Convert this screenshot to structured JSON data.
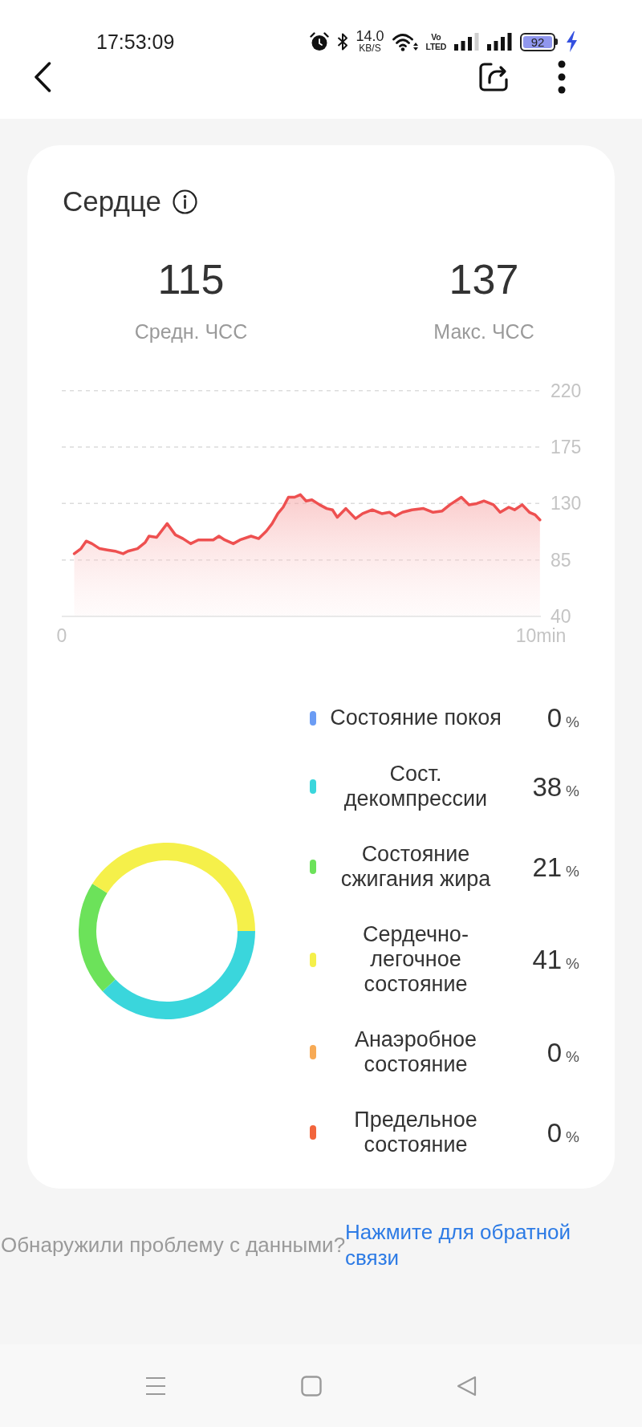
{
  "status_bar": {
    "time": "17:53:09",
    "net_speed": "14.0",
    "net_speed_unit": "KB/S",
    "volte_top": "Vo",
    "volte_bottom": "LTED",
    "battery": "92"
  },
  "card": {
    "title": "Сердце",
    "stats": [
      {
        "value": "115",
        "label": "Средн. ЧСС"
      },
      {
        "value": "137",
        "label": "Макс. ЧСС"
      }
    ],
    "heart_rate": {
      "chart_data": {
        "type": "area",
        "x": [
          0.26,
          0.4,
          0.51,
          0.63,
          0.79,
          0.95,
          1.11,
          1.28,
          1.38,
          1.58,
          1.74,
          1.82,
          1.98,
          2.2,
          2.37,
          2.53,
          2.69,
          2.85,
          3.16,
          3.28,
          3.4,
          3.58,
          3.72,
          3.95,
          4.11,
          4.27,
          4.39,
          4.51,
          4.62,
          4.73,
          4.86,
          4.98,
          5.1,
          5.22,
          5.38,
          5.53,
          5.65,
          5.75,
          5.93,
          6.13,
          6.28,
          6.48,
          6.68,
          6.84,
          6.96,
          7.11,
          7.31,
          7.55,
          7.75,
          7.94,
          8.1,
          8.34,
          8.5,
          8.66,
          8.81,
          9.01,
          9.15,
          9.33,
          9.45,
          9.61,
          9.76,
          9.88,
          9.98
        ],
        "values": [
          90,
          94,
          100,
          98,
          94,
          93,
          92,
          90,
          92,
          94,
          99,
          104,
          103,
          114,
          105,
          102,
          98,
          101,
          101,
          104,
          101,
          98,
          101,
          104,
          102,
          108,
          114,
          122,
          127,
          135,
          135,
          137,
          132,
          133,
          129,
          126,
          125,
          119,
          126,
          118,
          122,
          125,
          122,
          123,
          120,
          123,
          125,
          126,
          123,
          124,
          129,
          135,
          129,
          130,
          132,
          129,
          123,
          127,
          125,
          129,
          123,
          121,
          117
        ],
        "xlim": [
          0,
          10
        ],
        "ylim": [
          40,
          220
        ],
        "xticks": [
          {
            "value": 0,
            "label": "0"
          },
          {
            "value": 10,
            "label": "10min"
          }
        ],
        "yticks": [
          40,
          85,
          130,
          175,
          220
        ],
        "grid": true
      }
    },
    "zones": {
      "chart_data": {
        "type": "donut",
        "categories": [
          "Состояние покоя",
          "Сост. декомпрессии",
          "Состояние сжигания жира",
          "Сердечно-легочное состояние",
          "Анаэробное состояние",
          "Предельное состояние"
        ],
        "values": [
          0,
          38,
          21,
          41,
          0,
          0
        ]
      },
      "legend": [
        {
          "color": "#6b9cf4",
          "percent": "0",
          "unit": "%"
        },
        {
          "color": "#3ad6dc",
          "percent": "38",
          "unit": "%"
        },
        {
          "color": "#6ce25a",
          "percent": "21",
          "unit": "%"
        },
        {
          "color": "#f5f04a",
          "percent": "41",
          "unit": "%"
        },
        {
          "color": "#f7aa55",
          "percent": "0",
          "unit": "%"
        },
        {
          "color": "#f2653c",
          "percent": "0",
          "unit": "%"
        }
      ]
    }
  },
  "feedback": {
    "text": "Обнаружили проблему с данными?",
    "link": "Нажмите для обратной связи"
  }
}
